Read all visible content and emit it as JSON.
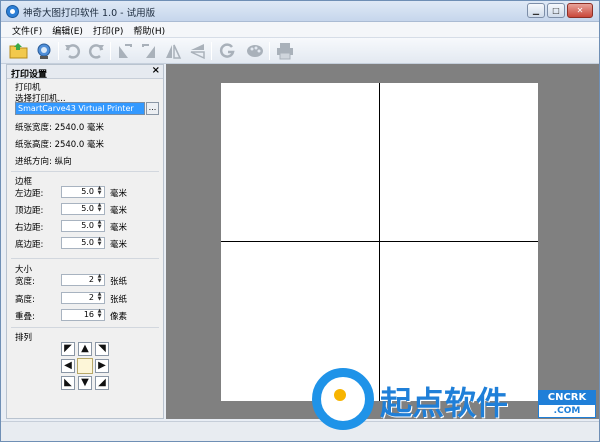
{
  "window": {
    "title": "神奇大图打印软件 1.0 - 试用版",
    "buttons": {
      "minimize": "▁",
      "maximize": "□",
      "close": "✕"
    }
  },
  "menu": [
    "文件(F)",
    "编辑(E)",
    "打印(P)",
    "帮助(H)"
  ],
  "toolbar": {
    "icons": [
      "open-folder-icon",
      "camera-icon",
      "undo-icon",
      "redo-icon",
      "flip-left-icon",
      "flip-right-icon",
      "mirror-horizontal-icon",
      "mirror-vertical-icon",
      "g-icon",
      "palette-icon",
      "printer-icon"
    ]
  },
  "panel": {
    "title": "打印设置",
    "close": "×",
    "printer": {
      "heading": "打印机",
      "select_label": "选择打印机...",
      "selected": "SmartCarve43 Virtual Printer",
      "browse": "...",
      "paper_width": "纸张宽度: 2540.0 毫米",
      "paper_height": "纸张高度: 2540.0 毫米",
      "feed_direction": "进纸方向: 纵向"
    },
    "margins": {
      "heading": "边框",
      "rows": [
        {
          "label": "左边距:",
          "value": "5.0",
          "unit": "毫米"
        },
        {
          "label": "顶边距:",
          "value": "5.0",
          "unit": "毫米"
        },
        {
          "label": "右边距:",
          "value": "5.0",
          "unit": "毫米"
        },
        {
          "label": "底边距:",
          "value": "5.0",
          "unit": "毫米"
        }
      ]
    },
    "size": {
      "heading": "大小",
      "rows": [
        {
          "label": "宽度:",
          "value": "2",
          "unit": "张纸"
        },
        {
          "label": "高度:",
          "value": "2",
          "unit": "张纸"
        },
        {
          "label": "重叠:",
          "value": "16",
          "unit": "像素"
        }
      ]
    },
    "arrange": {
      "heading": "排列",
      "arrows": [
        "◤",
        "▲",
        "◥",
        "◀",
        "",
        "▶",
        "◣",
        "▼",
        "◢"
      ]
    }
  },
  "watermark": {
    "brand": "起点软件",
    "badge_top": "CNCRK",
    "badge_bottom": ".COM"
  },
  "colors": {
    "selection": "#3399ff",
    "canvas_bg": "#808080",
    "brand_blue": "#1f7fd8"
  }
}
